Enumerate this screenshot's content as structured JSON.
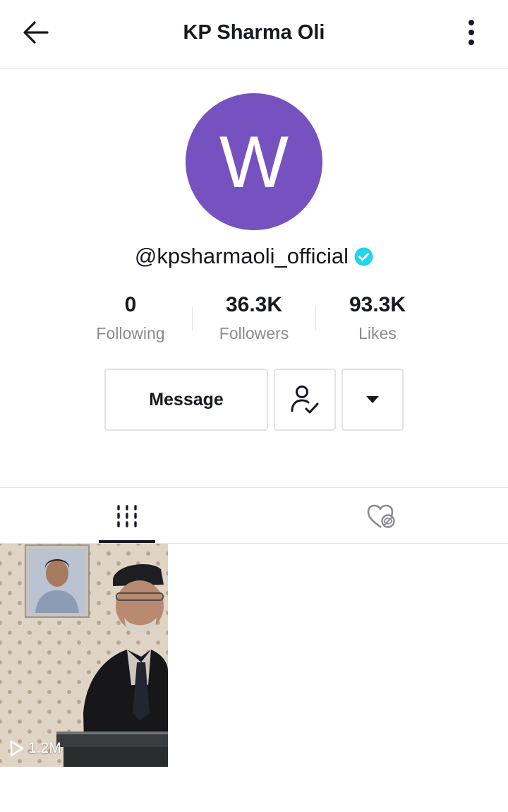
{
  "header": {
    "title": "KP Sharma Oli",
    "back_icon": "arrow-left-icon",
    "more_icon": "more-vertical-icon"
  },
  "profile": {
    "avatar_letter": "W",
    "avatar_color": "#7652c0",
    "handle": "@kpsharmaoli_official",
    "verified_color": "#20d5ec"
  },
  "stats": {
    "following": {
      "value": "0",
      "label": "Following"
    },
    "followers": {
      "value": "36.3K",
      "label": "Followers"
    },
    "likes": {
      "value": "93.3K",
      "label": "Likes"
    }
  },
  "actions": {
    "message_label": "Message",
    "follow_icon": "user-check-icon",
    "dropdown_icon": "caret-down-icon"
  },
  "tabs": [
    {
      "name": "videos",
      "icon": "grid-icon",
      "active": true
    },
    {
      "name": "liked",
      "icon": "heart-hidden-icon",
      "active": false
    }
  ],
  "videos": [
    {
      "views": "1.2M",
      "play_icon": "play-outline-icon"
    }
  ]
}
